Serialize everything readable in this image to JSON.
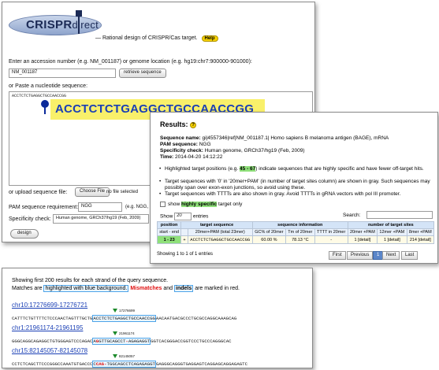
{
  "input_form": {
    "logo": {
      "crispr": "CRISPR",
      "direct": "direct"
    },
    "tagline": "— Rational design of CRISPR/Cas target.",
    "help_label": "Help",
    "accession_label": "Enter an accession number (e.g. NM_001187) or genome location (e.g. hg19:chr7:900000-901000):",
    "accession_value": "NM_001187",
    "retrieve_label": "retrieve sequence",
    "paste_label": "or Paste a nucleotide sequence:",
    "seq_small": "ACCTCTCTGAGGCTGCCAACCGG",
    "seq_big": "ACCTCTCTGAGGCTGCCAACCGG",
    "upload_label": "or upload sequence file:",
    "choose_file_label": "Choose File",
    "no_file_label": "no file selected",
    "pam_label": "PAM sequence requirement:",
    "pam_value": "NGG",
    "pam_hint": "(e.g. NGG, NRG",
    "specificity_label": "Specificity check:",
    "specificity_value": "Human genome, GRCh37/hg19 (Feb, 2009)",
    "design_label": "design"
  },
  "results": {
    "title": "Results:",
    "help_icon": "?",
    "sequence_name_label": "Sequence name:",
    "sequence_name": "gi|4557346|ref|NM_001187.1| Homo sapiens B melanoma antigen (BAGE), mRNA",
    "pam_seq_label": "PAM sequence:",
    "pam_seq": "NGG",
    "spec_label": "Specificity check:",
    "spec_value": "Human genome, GRCh37/hg19 (Feb, 2009)",
    "time_label": "Time:",
    "time_value": "2014-04-20 14:12:22",
    "bullet1_pre": "Highlighted target positions (e.g.",
    "bullet1_range": "45 - 67",
    "bullet1_post": ") indicate sequences that are highly specific and have fewer off-target hits.",
    "bullet2": "Target sequences with '0' in '20mer+PAM' (in number of target sites column) are shown in gray. Such sequences may possibly span over exon-exon junctions, so avoid using these.",
    "bullet3": "Target sequences with TTTTs are also shown in gray. Avoid TTTTs in gRNA vectors with pol III promoter.",
    "show_specific_pre": "show",
    "show_specific_hl": "highly specific",
    "show_specific_post": "target only",
    "show_label": "Show",
    "entries_value": "20",
    "entries_label": "entries",
    "search_label": "Search:",
    "table": {
      "group_headers": [
        "position",
        "target sequence",
        "sequence information",
        "number of target sites"
      ],
      "col_headers": [
        "start - end",
        "",
        "20mer+PAM (total 23mer)",
        "GC% of 20mer",
        "Tm of 20mer",
        "TTTT in 20mer",
        "20mer +PAM",
        "12mer +PAM",
        "8mer +PAM"
      ],
      "row": [
        "1 - 23",
        "+",
        "ACCTCTCTGAGGCTGCCAACCGG",
        "60.00 %",
        "78.13 °C",
        "-",
        "1 [detail]",
        "1 [detail]",
        "214 [detail]"
      ]
    },
    "showing_text": "Showing 1 to 1 of 1 entries",
    "pager": [
      "First",
      "Previous",
      "1",
      "Next",
      "Last"
    ]
  },
  "alignments": {
    "line1": "Showing first 200 results for each strand of the query sequence.",
    "line2_pre": "Matches are",
    "line2_hl": "highlighted with blue background.",
    "line2_mm": "Mismatches",
    "line2_and": "and",
    "line2_indels": "indels",
    "line2_post": "are marked in red.",
    "hits": [
      {
        "location": "chr10:17276699-17276721",
        "position": "17276699",
        "pre": "CATTTCTGTTTTCTCCCAACTAGTTTGCTG",
        "match": "ACCTCTCTGAGGCTGCCAACCGG",
        "post": "AACAATGACGCCCTGCGCCAGGCAAAGCAG"
      },
      {
        "location": "chr1:21961174-21961195",
        "position": "21961174",
        "pre": "GGGCAGGCAGAGGCTGTGGGAGTCCCAGAC",
        "match_a": "A",
        "mm1": "G",
        "match_b": "GTTGCAGCCT",
        "mm2": "-",
        "match_c": "AGAGAGGT",
        "post": "GGTCACGGGACCGGTCCCTGCCCAGGGCAC"
      },
      {
        "location": "chr15:82145057-82145078",
        "position": "82145057",
        "pre": "CCTCTCAGCTTCCCGGGCCAAATGTGACCC",
        "match_a": "C",
        "mm1": "CAG",
        "mm2": "-",
        "match_c": "TGGCAGCCTCAGAGAGGT",
        "post": "GAGGGCAGGGTGAGGAGTCAGGAGCAGGAGAGTC"
      }
    ]
  },
  "colors": {
    "highlight_yellow": "#f9f06a",
    "sequence_blue": "#1a3fb5",
    "match_border": "#4ea4e8",
    "mismatch_red": "#e01010",
    "help_yellow": "#f5d000",
    "table_header": "#d4e4f7"
  }
}
